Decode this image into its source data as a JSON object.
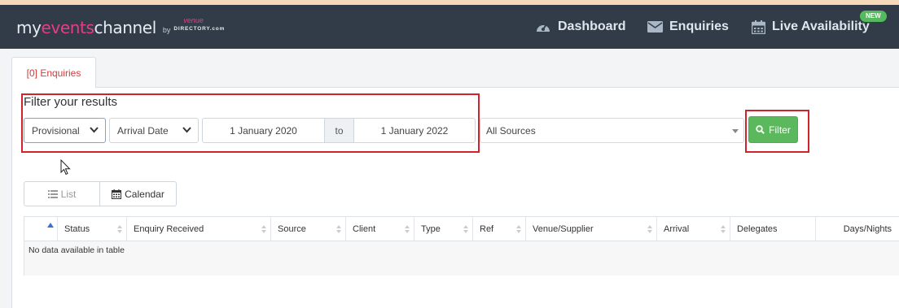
{
  "app": {
    "logo_my": "my",
    "logo_events": "events",
    "logo_channel": "channel",
    "logo_by": "by",
    "logo_venue": "venue",
    "logo_directory": "DIRECTORY.com"
  },
  "nav": {
    "items": [
      {
        "label": "Dashboard",
        "icon": "dashboard-gauge-icon"
      },
      {
        "label": "Enquiries",
        "icon": "envelope-icon"
      },
      {
        "label": "Live Availability",
        "icon": "calendar-icon",
        "badge": "NEW"
      }
    ]
  },
  "tabs": [
    {
      "label": "[0] Enquiries",
      "active": true
    }
  ],
  "filter": {
    "title": "Filter your results",
    "status_value": "Provisional",
    "date_type_value": "Arrival Date",
    "date_from": "1 January 2020",
    "date_separator": "to",
    "date_to": "1 January 2022",
    "sources_value": "All Sources",
    "button_label": "Filter"
  },
  "view_toggle": {
    "list_label": "List",
    "calendar_label": "Calendar"
  },
  "table": {
    "columns": [
      "",
      "Status",
      "Enquiry Received",
      "Source",
      "Client",
      "Type",
      "Ref",
      "Venue/Supplier",
      "Arrival",
      "Delegates",
      "Days/Nights"
    ],
    "empty_message": "No data available in table"
  },
  "colors": {
    "navbar": "#313c48",
    "accent_pink": "#ea3a8a",
    "badge_green": "#55b95d",
    "filter_green": "#5cb85c",
    "tab_red": "#d23a3a",
    "highlight_red": "#d0232c"
  }
}
